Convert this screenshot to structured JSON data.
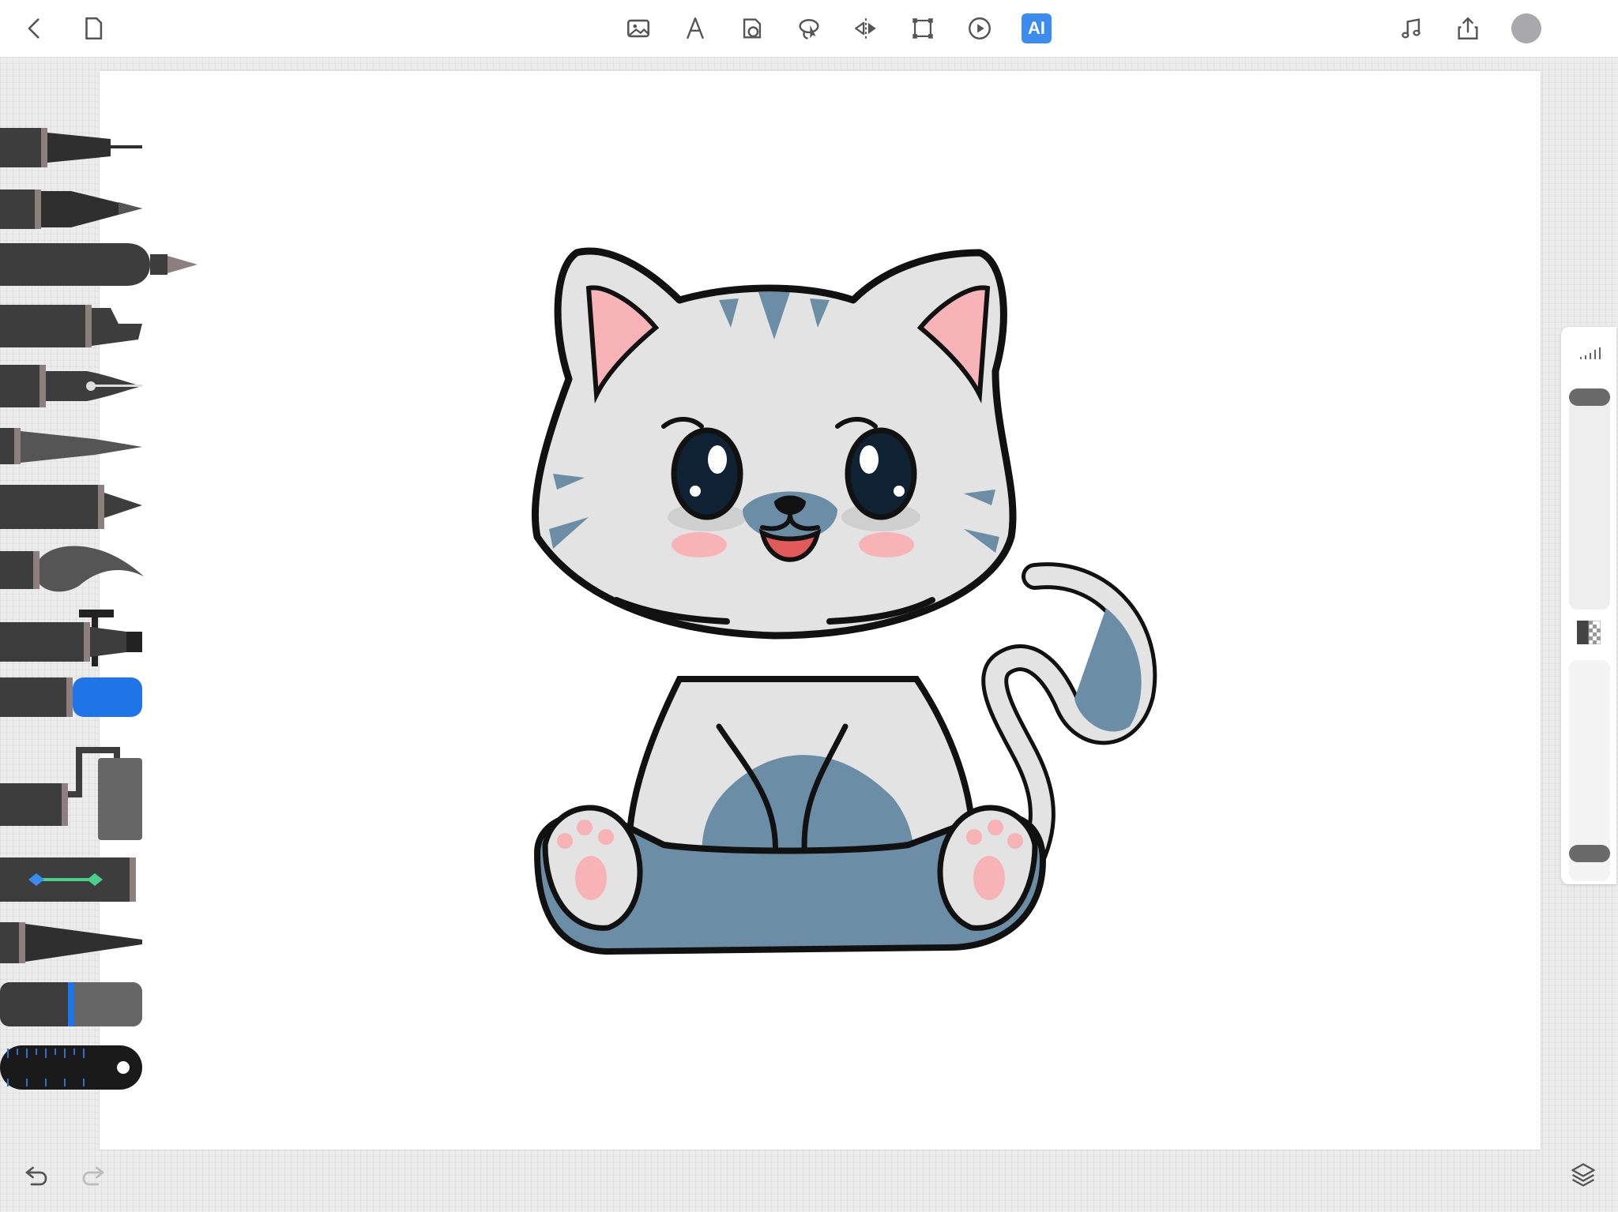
{
  "app": {
    "name": "drawing-canvas"
  },
  "toolbar": {
    "left": [
      {
        "name": "back-icon"
      },
      {
        "name": "document-icon"
      }
    ],
    "center": [
      {
        "name": "image-icon"
      },
      {
        "name": "text-icon"
      },
      {
        "name": "shape-icon"
      },
      {
        "name": "lasso-icon"
      },
      {
        "name": "mirror-icon"
      },
      {
        "name": "transform-icon"
      },
      {
        "name": "play-icon"
      },
      {
        "name": "ai-icon",
        "label": "AI"
      }
    ],
    "right": [
      {
        "name": "music-icon"
      },
      {
        "name": "share-icon"
      },
      {
        "name": "color-swatch",
        "color": "#a9a9ad"
      }
    ]
  },
  "tools": [
    "technical-pen",
    "pencil",
    "marker",
    "highlighter",
    "fountain-pen",
    "calligraphy-pen",
    "crayon",
    "brush",
    "airbrush",
    "eraser",
    "paint-roller",
    "gradient-tool",
    "texture-brush",
    "smudge-tool",
    "ruler"
  ],
  "side_panel": {
    "brush_size_fraction": 0.08,
    "opacity_fraction": 1.0
  },
  "colors": {
    "accent": "#3b8cf0",
    "cat_outline": "#111111",
    "cat_fur": "#e3e3e3",
    "cat_stripe": "#6b8ea6",
    "cat_pink": "#f7b3b5"
  },
  "bottom": {
    "left": [
      {
        "name": "undo-icon"
      },
      {
        "name": "redo-icon"
      }
    ],
    "right": [
      {
        "name": "layers-icon"
      }
    ]
  }
}
